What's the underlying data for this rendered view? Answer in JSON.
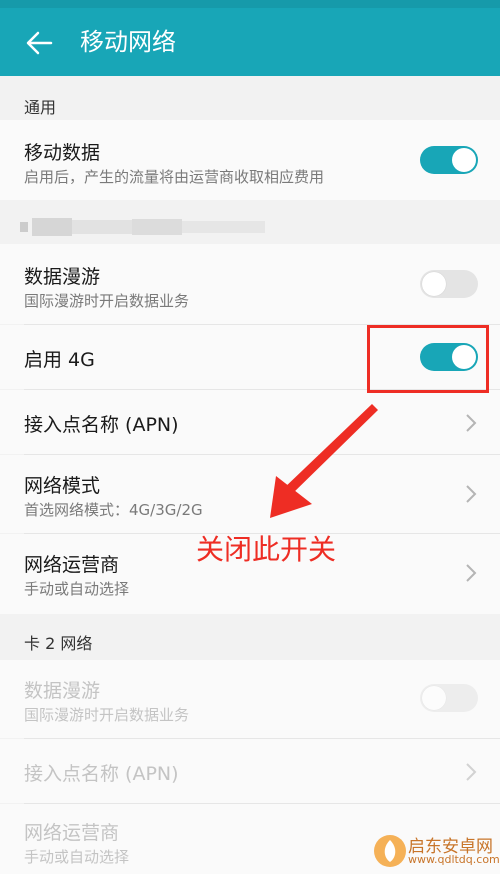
{
  "header": {
    "title": "移动网络",
    "back_icon": "arrow-left-icon"
  },
  "sections": {
    "general": {
      "label": "通用"
    },
    "card2": {
      "label": "卡 2 网络"
    }
  },
  "rows": {
    "mobile_data": {
      "title": "移动数据",
      "subtitle": "启用后，产生的流量将由运营商收取相应费用",
      "toggle": true
    },
    "roaming": {
      "title": "数据漫游",
      "subtitle": "国际漫游时开启数据业务",
      "toggle": false
    },
    "enable_4g": {
      "title": "启用 4G",
      "toggle": true
    },
    "apn": {
      "title": "接入点名称 (APN)"
    },
    "network_mode": {
      "title": "网络模式",
      "subtitle": "首选网络模式：4G/3G/2G"
    },
    "operator": {
      "title": "网络运营商",
      "subtitle": "手动或自动选择"
    },
    "card2_roaming": {
      "title": "数据漫游",
      "subtitle": "国际漫游时开启数据业务",
      "toggle": false
    },
    "card2_apn": {
      "title": "接入点名称 (APN)"
    },
    "card2_operator": {
      "title": "网络运营商",
      "subtitle": "手动或自动选择"
    }
  },
  "annotation": {
    "text": "关闭此开关",
    "color": "#ee2d24"
  },
  "watermark": {
    "title": "启东安卓网",
    "url": "www.qdltdq.com"
  },
  "colors": {
    "accent": "#18a6b7",
    "annotation": "#ee2d24"
  }
}
